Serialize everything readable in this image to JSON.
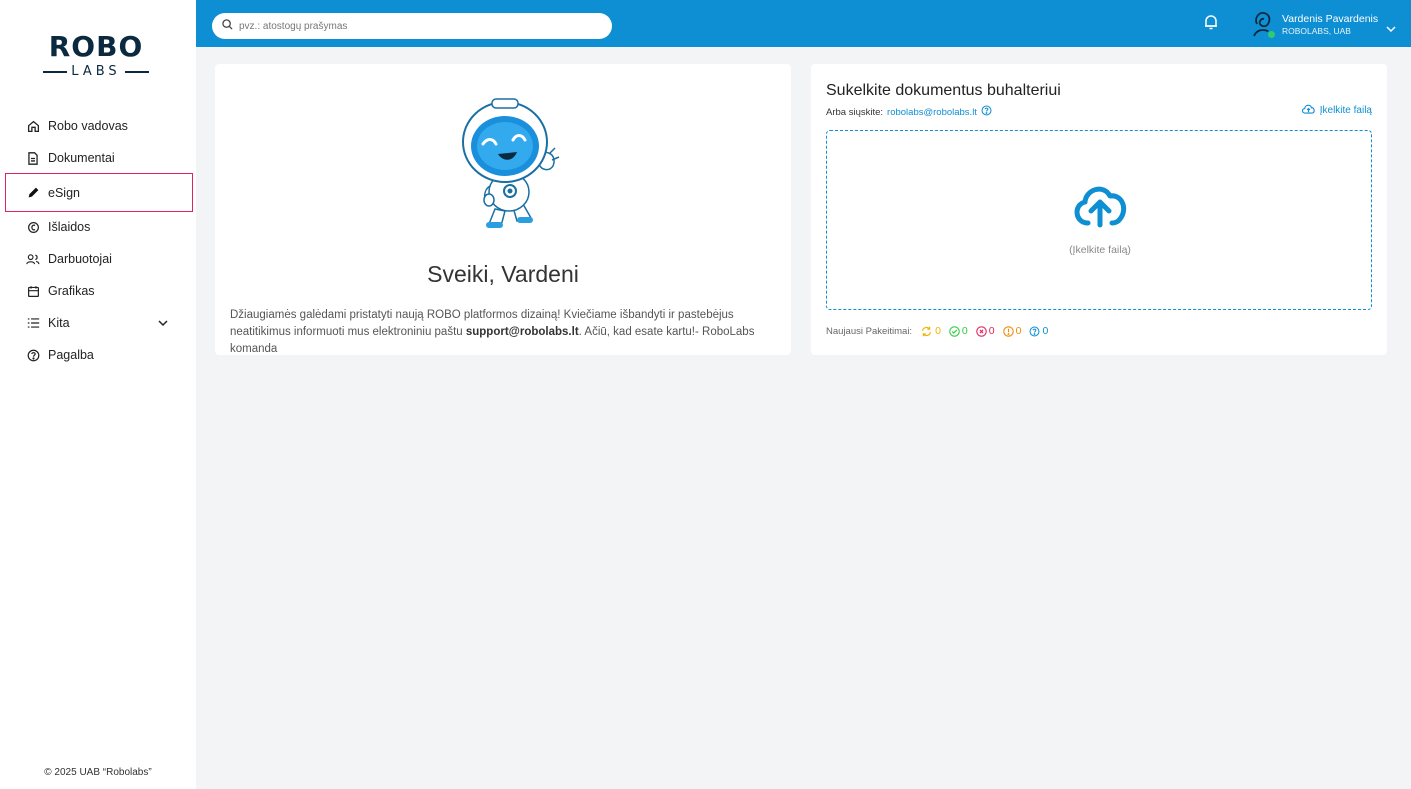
{
  "sidebar": {
    "logo_top": "ROBO",
    "logo_bottom": "LABS",
    "items": [
      {
        "label": "Robo vadovas",
        "icon": "home-icon"
      },
      {
        "label": "Dokumentai",
        "icon": "document-icon"
      },
      {
        "label": "eSign",
        "icon": "pen-icon",
        "active": true
      },
      {
        "label": "Išlaidos",
        "icon": "expenses-icon"
      },
      {
        "label": "Darbuotojai",
        "icon": "users-icon"
      },
      {
        "label": "Grafikas",
        "icon": "calendar-icon"
      },
      {
        "label": "Kita",
        "icon": "list-icon",
        "expandable": true
      },
      {
        "label": "Pagalba",
        "icon": "help-icon"
      }
    ],
    "copyright": "© 2025 UAB “Robolabs”"
  },
  "topbar": {
    "search_placeholder": "pvz.: atostogų prašymas",
    "user_name": "Vardenis Pavardenis",
    "user_company": "ROBOLABS, UAB",
    "status_color": "#2ecc71"
  },
  "welcome": {
    "greeting": "Sveiki, Vardeni",
    "intro_text": "Džiaugiamės galėdami pristatyti naują ROBO platformos dizainą! Kviečiame išbandyti ir pastebėjus neatitikimus informuoti mus elektroniniu paštu ",
    "intro_email": "support@robolabs.lt",
    "intro_tail": ". Ačiū, kad esate kartu!- RoboLabs komanda"
  },
  "upload": {
    "title": "Sukelkite dokumentus buhalteriui",
    "or_send": "Arba siųskite:",
    "email": "robolabs@robolabs.lt",
    "upload_link": "Įkelkite failą",
    "drop_text": "(Įkelkite failą)",
    "recent_label": "Naujausi Pakeitimai:",
    "statuses": [
      {
        "name": "processing",
        "count": "0",
        "color": "#f5b400"
      },
      {
        "name": "done",
        "count": "0",
        "color": "#2ecc40"
      },
      {
        "name": "rejected",
        "count": "0",
        "color": "#e0245e"
      },
      {
        "name": "warning",
        "count": "0",
        "color": "#f08a00"
      },
      {
        "name": "question",
        "count": "0",
        "color": "#0e8ed3"
      }
    ]
  },
  "colors": {
    "accent": "#0e8ed3",
    "active_outline": "#e0245e"
  }
}
